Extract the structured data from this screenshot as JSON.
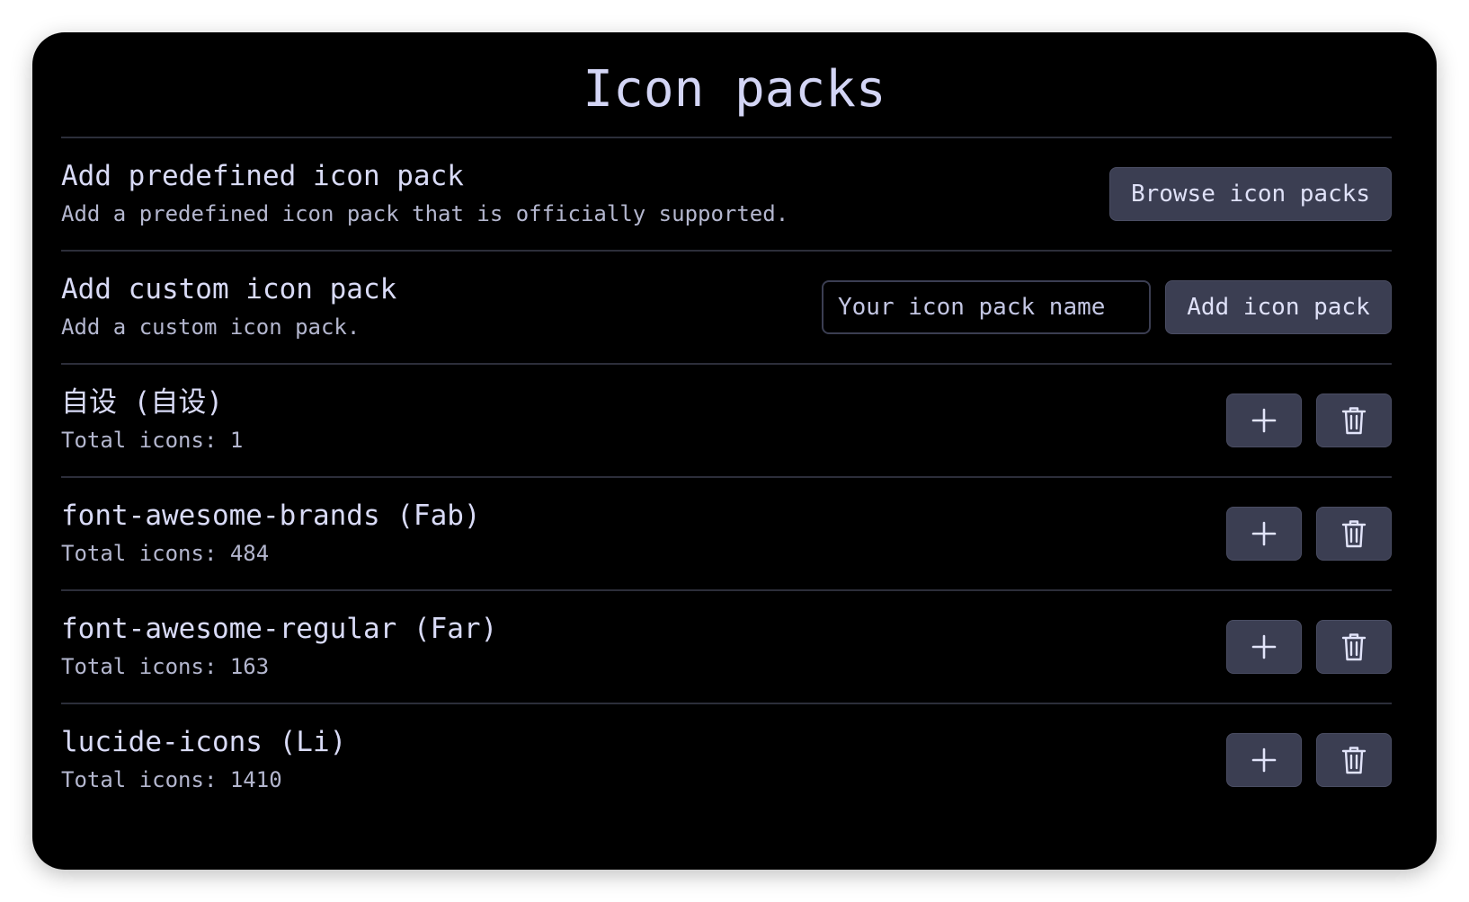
{
  "title": "Icon packs",
  "predefined": {
    "title": "Add predefined icon pack",
    "description": "Add a predefined icon pack that is officially supported.",
    "button_label": "Browse icon packs"
  },
  "custom": {
    "title": "Add custom icon pack",
    "description": "Add a custom icon pack.",
    "input_placeholder": "Your icon pack name",
    "input_value": "",
    "button_label": "Add icon pack"
  },
  "packs": [
    {
      "name": "自设 (自设)",
      "total": "Total icons: 1"
    },
    {
      "name": "font-awesome-brands (Fab)",
      "total": "Total icons: 484"
    },
    {
      "name": "font-awesome-regular (Far)",
      "total": "Total icons: 163"
    },
    {
      "name": "lucide-icons (Li)",
      "total": "Total icons: 1410"
    }
  ],
  "icons": {
    "add": "plus-icon",
    "delete": "trash-icon"
  },
  "colors": {
    "background": "#000000",
    "button": "#3b3e52",
    "text": "#d6d8f2",
    "divider": "#2c2e3a"
  }
}
